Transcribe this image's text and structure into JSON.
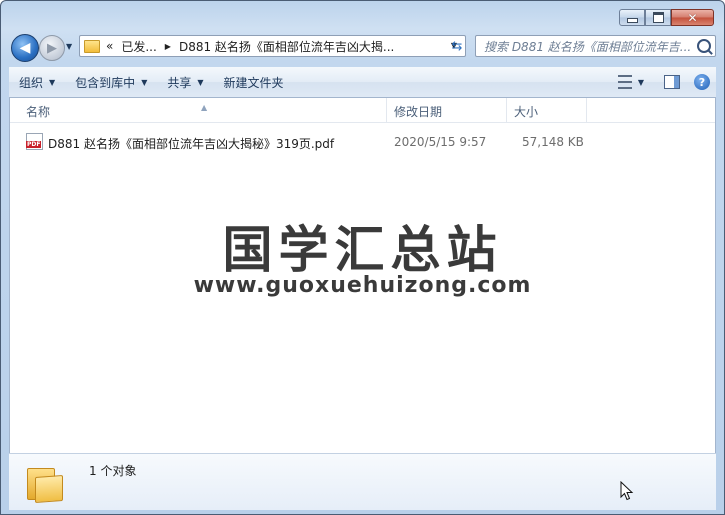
{
  "window": {
    "controls": {
      "minimize": "minimize",
      "maximize": "maximize",
      "close": "✕"
    }
  },
  "nav": {
    "back_icon": "arrow-left-icon",
    "forward_icon": "arrow-right-icon",
    "address": {
      "overflow": "«",
      "crumbs": [
        "已发...",
        "D881 赵名扬《面相部位流年吉凶大揭..."
      ]
    },
    "search_placeholder": "搜索 D881 赵名扬《面相部位流年吉..."
  },
  "toolbar": {
    "organize": "组织",
    "include_in_library": "包含到库中",
    "share": "共享",
    "new_folder": "新建文件夹"
  },
  "columns": {
    "name": "名称",
    "date_modified": "修改日期",
    "size": "大小"
  },
  "files": [
    {
      "name": "D881 赵名扬《面相部位流年吉凶大揭秘》319页.pdf",
      "date": "2020/5/15 9:57",
      "size": "57,148 KB",
      "icon": "pdf-file-icon"
    }
  ],
  "watermark": {
    "title": "国学汇总站",
    "url": "www.guoxuehuizong.com"
  },
  "details_pane": {
    "count_text": "1 个对象"
  }
}
